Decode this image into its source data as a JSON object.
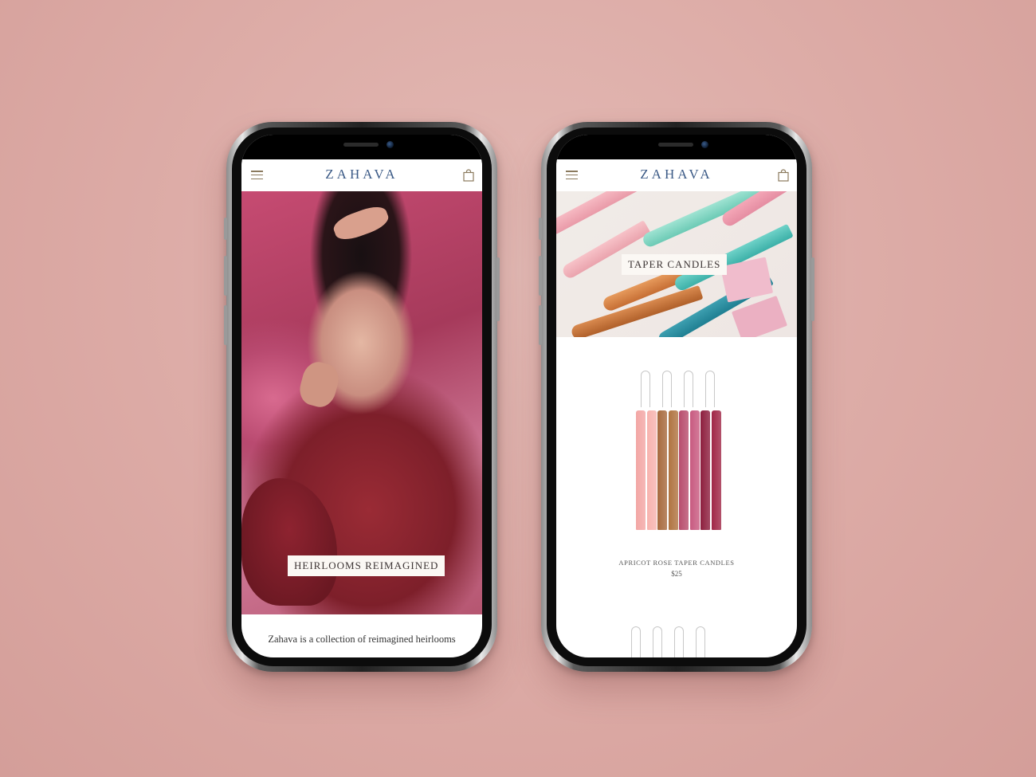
{
  "left_screen": {
    "brand": "ZAHAVA",
    "hero_caption": "HEIRLOOMS REIMAGINED",
    "intro_text": "Zahava is a collection of reimagined heirlooms"
  },
  "right_screen": {
    "brand": "ZAHAVA",
    "banner_caption": "TAPER CANDLES",
    "product": {
      "name": "APRICOT ROSE TAPER CANDLES",
      "price": "$25",
      "candle_colors": [
        "#f3a6a4",
        "#f7b3ae",
        "#a76a3e",
        "#b07441",
        "#b84e6d",
        "#c85a80",
        "#8d1f3e",
        "#a02646"
      ]
    }
  },
  "colors": {
    "background": "#dcaaa5",
    "brand_text": "#3b5a86",
    "icon": "#8b7a5e"
  },
  "icons": [
    "hamburger-menu-icon",
    "shopping-bag-icon"
  ]
}
